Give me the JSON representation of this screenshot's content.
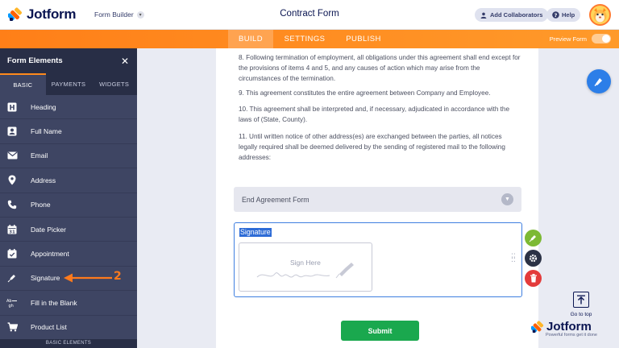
{
  "header": {
    "brand": "Jotform",
    "builder_label": "Form Builder",
    "form_title": "Contract Form",
    "collaborators_label": "Add Collaborators",
    "help_label": "Help"
  },
  "nav": {
    "tabs": [
      "BUILD",
      "SETTINGS",
      "PUBLISH"
    ],
    "active": "BUILD",
    "preview_label": "Preview Form",
    "preview_on": false
  },
  "sidebar": {
    "title": "Form Elements",
    "tabs": [
      "BASIC",
      "PAYMENTS",
      "WIDGETS"
    ],
    "active_tab": "BASIC",
    "items": [
      {
        "label": "Heading",
        "icon": "heading-icon"
      },
      {
        "label": "Full Name",
        "icon": "person-icon"
      },
      {
        "label": "Email",
        "icon": "envelope-icon"
      },
      {
        "label": "Address",
        "icon": "map-pin-icon"
      },
      {
        "label": "Phone",
        "icon": "phone-icon"
      },
      {
        "label": "Date Picker",
        "icon": "calendar-icon"
      },
      {
        "label": "Appointment",
        "icon": "appointment-icon"
      },
      {
        "label": "Signature",
        "icon": "pen-icon"
      },
      {
        "label": "Fill in the Blank",
        "icon": "fill-blank-icon"
      },
      {
        "label": "Product List",
        "icon": "cart-icon"
      }
    ],
    "footer": "BASIC ELEMENTS"
  },
  "annotation": {
    "number": "2"
  },
  "form": {
    "paragraphs": [
      "8. Following termination of employment, all obligations under this agreement shall end except for the provisions of items 4 and 5, and any causes of action which may arise from the circumstances of the termination.",
      "9. This agreement constitutes the entire agreement between Company and Employee.",
      "10. This agreement shall be interpreted and, if necessary, adjudicated in accordance with the laws of (State, County).",
      "11. Until written notice of other address(es) are exchanged between the parties, all notices legally required shall be deemed delivered by the sending of registered mail to the following addresses:"
    ],
    "section_title": "End Agreement Form",
    "signature_label": "Signature",
    "signature_placeholder": "Sign Here",
    "submit_label": "Submit"
  },
  "right": {
    "goto_top": "Go to top",
    "watermark": "Jotform",
    "tagline": "Powerful forms get it done"
  },
  "colors": {
    "orange": "#ff8a1c",
    "navy": "#0a1551",
    "sidebar": "#3e4563",
    "submit": "#1aa84e",
    "selection": "#3f7fe0",
    "delete": "#e33b3b",
    "edit": "#7cb934"
  }
}
